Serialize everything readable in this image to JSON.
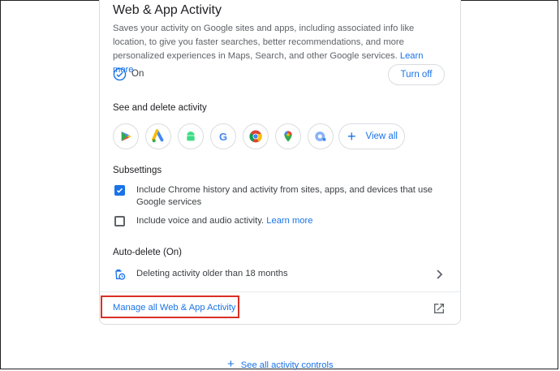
{
  "card": {
    "title": "Web & App Activity",
    "description": "Saves your activity on Google sites and apps, including associated info like location, to give you faster searches, better recommendations, and more personalized experiences in Maps, Search, and other Google services.",
    "learn_more": "Learn more",
    "status": "On",
    "turn_off_label": "Turn off"
  },
  "see_delete": {
    "heading": "See and delete activity",
    "apps": [
      "Google Play",
      "Google Ads",
      "Android",
      "Google",
      "Chrome",
      "Google Maps",
      "Google Lens"
    ],
    "view_all_label": "View all"
  },
  "subsettings": {
    "heading": "Subsettings",
    "items": [
      {
        "label": "Include Chrome history and activity from sites, apps, and devices that use Google services",
        "checked": true
      },
      {
        "label": "Include voice and audio activity.",
        "checked": false,
        "link": "Learn more"
      }
    ]
  },
  "auto_delete": {
    "heading": "Auto-delete (On)",
    "text": "Deleting activity older than 18 months"
  },
  "manage_link": "Manage all Web & App Activity",
  "see_all_controls": "See all activity controls",
  "colors": {
    "accent": "#1a73e8",
    "highlight": "#d93025"
  }
}
